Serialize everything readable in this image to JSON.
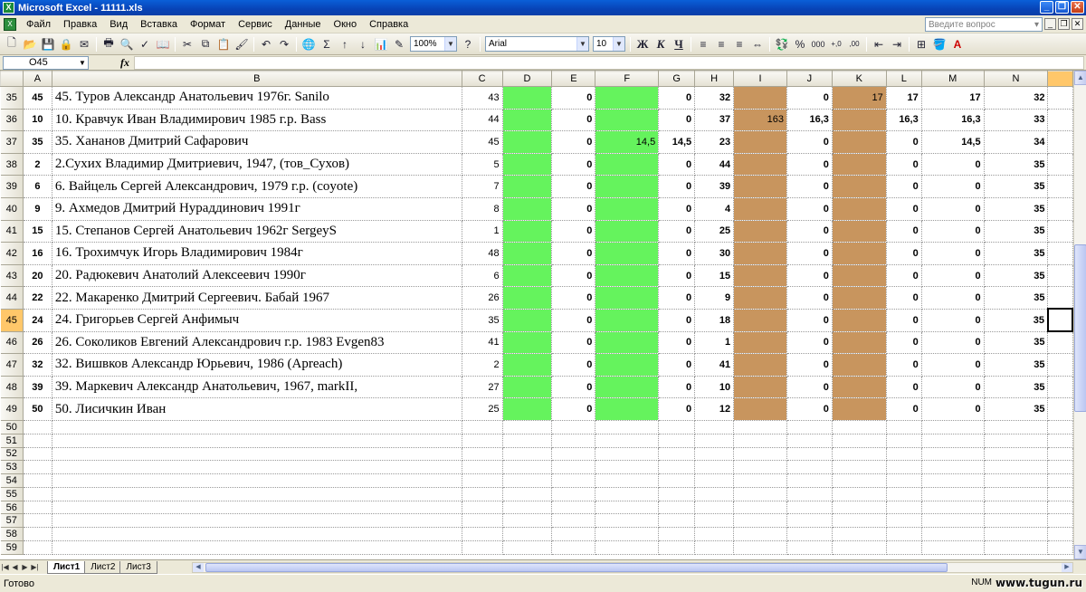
{
  "window": {
    "title": "Microsoft Excel - 11111.xls"
  },
  "menu": [
    "Файл",
    "Правка",
    "Вид",
    "Вставка",
    "Формат",
    "Сервис",
    "Данные",
    "Окно",
    "Справка"
  ],
  "help_search": {
    "placeholder": "Введите вопрос"
  },
  "toolbar": {
    "zoom": "100%",
    "font": "Arial",
    "font_size": "10",
    "bold": "Ж",
    "italic": "К",
    "underline": "Ч",
    "percent": "%",
    "thousands": "000",
    "sigma": "Σ"
  },
  "formula_bar": {
    "name_box": "O45",
    "fx": "fx",
    "content": ""
  },
  "columns": [
    "A",
    "B",
    "C",
    "D",
    "E",
    "F",
    "G",
    "H",
    "I",
    "J",
    "K",
    "L",
    "M",
    "N",
    ""
  ],
  "rows": [
    {
      "num": "35",
      "a": "45",
      "b": "45. Туров Александр Анатольевич 1976г. Sanilo",
      "c": "43",
      "e": "0",
      "f": "",
      "g": "0",
      "h": "32",
      "i": "",
      "j": "0",
      "k": "17",
      "l": "17",
      "m": "17",
      "n": "32"
    },
    {
      "num": "36",
      "a": "10",
      "b": "10. Кравчук Иван Владимирович 1985 г.р. Bass",
      "c": "44",
      "e": "0",
      "f": "",
      "g": "0",
      "h": "37",
      "i": "163",
      "j": "16,3",
      "k": "",
      "l": "16,3",
      "m": "16,3",
      "n": "33"
    },
    {
      "num": "37",
      "a": "35",
      "b": "35. Хананов Дмитрий Сафарович",
      "c": "45",
      "e": "0",
      "f": "14,5",
      "g": "14,5",
      "h": "23",
      "i": "",
      "j": "0",
      "k": "",
      "l": "0",
      "m": "14,5",
      "n": "34"
    },
    {
      "num": "38",
      "a": "2",
      "b": "2.Сухих Владимир Дмитриевич, 1947, (тов_Сухов)",
      "c": "5",
      "e": "0",
      "f": "",
      "g": "0",
      "h": "44",
      "i": "",
      "j": "0",
      "k": "",
      "l": "0",
      "m": "0",
      "n": "35"
    },
    {
      "num": "39",
      "a": "6",
      "b": "6. Вайцель Сергей Александрович, 1979 г.р. (coyote)",
      "c": "7",
      "e": "0",
      "f": "",
      "g": "0",
      "h": "39",
      "i": "",
      "j": "0",
      "k": "",
      "l": "0",
      "m": "0",
      "n": "35"
    },
    {
      "num": "40",
      "a": "9",
      "b": "9. Ахмедов Дмитрий Нураддинович 1991г",
      "c": "8",
      "e": "0",
      "f": "",
      "g": "0",
      "h": "4",
      "i": "",
      "j": "0",
      "k": "",
      "l": "0",
      "m": "0",
      "n": "35"
    },
    {
      "num": "41",
      "a": "15",
      "b": "15. Степанов Сергей Анатольевич 1962г SergeyS",
      "c": "1",
      "e": "0",
      "f": "",
      "g": "0",
      "h": "25",
      "i": "",
      "j": "0",
      "k": "",
      "l": "0",
      "m": "0",
      "n": "35"
    },
    {
      "num": "42",
      "a": "16",
      "b": "16. Трохимчук Игорь Владимирович 1984г",
      "c": "48",
      "e": "0",
      "f": "",
      "g": "0",
      "h": "30",
      "i": "",
      "j": "0",
      "k": "",
      "l": "0",
      "m": "0",
      "n": "35"
    },
    {
      "num": "43",
      "a": "20",
      "b": "20. Радюкевич Анатолий Алексеевич 1990г",
      "c": "6",
      "e": "0",
      "f": "",
      "g": "0",
      "h": "15",
      "i": "",
      "j": "0",
      "k": "",
      "l": "0",
      "m": "0",
      "n": "35"
    },
    {
      "num": "44",
      "a": "22",
      "b": "22. Макаренко Дмитрий Сергеевич. Бабай 1967",
      "c": "26",
      "e": "0",
      "f": "",
      "g": "0",
      "h": "9",
      "i": "",
      "j": "0",
      "k": "",
      "l": "0",
      "m": "0",
      "n": "35"
    },
    {
      "num": "45",
      "a": "24",
      "b": "24. Григорьев Сергей Анфимыч",
      "c": "35",
      "e": "0",
      "f": "",
      "g": "0",
      "h": "18",
      "i": "",
      "j": "0",
      "k": "",
      "l": "0",
      "m": "0",
      "n": "35"
    },
    {
      "num": "46",
      "a": "26",
      "b": "26. Соколиков Евгений Александрович г.р. 1983 Evgen83",
      "c": "41",
      "e": "0",
      "f": "",
      "g": "0",
      "h": "1",
      "i": "",
      "j": "0",
      "k": "",
      "l": "0",
      "m": "0",
      "n": "35"
    },
    {
      "num": "47",
      "a": "32",
      "b": "32. Вишвков Александр Юрьевич, 1986 (Apreach)",
      "c": "2",
      "e": "0",
      "f": "",
      "g": "0",
      "h": "41",
      "i": "",
      "j": "0",
      "k": "",
      "l": "0",
      "m": "0",
      "n": "35"
    },
    {
      "num": "48",
      "a": "39",
      "b": "39. Маркевич Александр Анатольевич, 1967, markII,",
      "c": "27",
      "e": "0",
      "f": "",
      "g": "0",
      "h": "10",
      "i": "",
      "j": "0",
      "k": "",
      "l": "0",
      "m": "0",
      "n": "35"
    },
    {
      "num": "49",
      "a": "50",
      "b": "50. Лисичкин Иван",
      "c": "25",
      "e": "0",
      "f": "",
      "g": "0",
      "h": "12",
      "i": "",
      "j": "0",
      "k": "",
      "l": "0",
      "m": "0",
      "n": "35"
    }
  ],
  "empty_rows": [
    "50",
    "51",
    "52",
    "53",
    "54",
    "55",
    "56",
    "57",
    "58",
    "59"
  ],
  "sheets": [
    "Лист1",
    "Лист2",
    "Лист3"
  ],
  "status": {
    "text": "Готово",
    "num": "NUM"
  },
  "watermark": "www.tugun.ru",
  "colors": {
    "green": "#65f35d",
    "tan": "#c8955e",
    "selection": "#ffc76a"
  }
}
